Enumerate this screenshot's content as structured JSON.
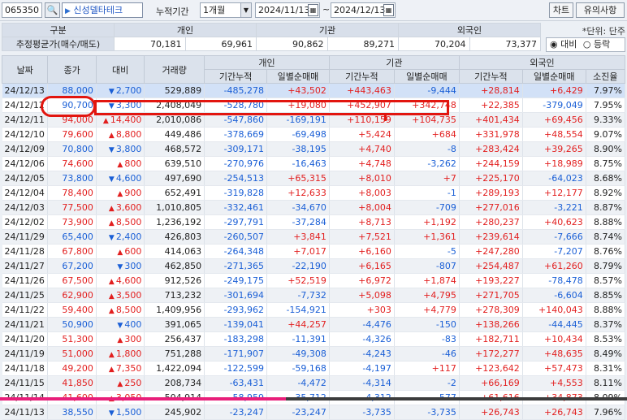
{
  "toolbar": {
    "code": "065350",
    "stock_name": "신성델타테크",
    "period_label": "누적기간",
    "period_value": "1개월",
    "date_from": "2024/11/13",
    "date_sep": "~",
    "date_to": "2024/12/13",
    "chart_button": "차트",
    "notice_button": "유의사항"
  },
  "summary": {
    "header": [
      "구분",
      "개인",
      "기관",
      "외국인"
    ],
    "row_label": "추정평균가(매수/매도)",
    "values": [
      "70,181",
      "69,961",
      "90,862",
      "89,271",
      "70,204",
      "73,377"
    ]
  },
  "unit_label": "*단위: 단주",
  "radio": {
    "selected": "대비",
    "other": "등락"
  },
  "grid": {
    "headers_top": [
      "날짜",
      "종가",
      "대비",
      "거래량",
      "개인",
      "기관",
      "외국인"
    ],
    "headers_sub": [
      "기간누적",
      "일별순매매",
      "기간누적",
      "일별순매매",
      "기간누적",
      "일별순매매",
      "소진율"
    ],
    "rows": [
      {
        "date": "24/12/13",
        "close": "88,000",
        "dir": "down",
        "chg": "2,700",
        "vol": "529,889",
        "p_cum": "-485,278",
        "p_day": "+43,502",
        "i_cum": "+443,463",
        "i_day": "-9,444",
        "f_cum": "+28,814",
        "f_day": "+6,429",
        "rate": "7.97%"
      },
      {
        "date": "24/12/12",
        "close": "90,700",
        "dir": "down",
        "chg": "3,300",
        "vol": "2,408,049",
        "p_cum": "-528,780",
        "p_day": "+19,080",
        "i_cum": "+452,907",
        "i_day": "+342,748",
        "f_cum": "+22,385",
        "f_day": "-379,049",
        "rate": "7.95%"
      },
      {
        "date": "24/12/11",
        "close": "94,000",
        "dir": "up",
        "chg": "14,400",
        "vol": "2,010,086",
        "p_cum": "-547,860",
        "p_day": "-169,191",
        "i_cum": "+110,159",
        "i_day": "+104,735",
        "f_cum": "+401,434",
        "f_day": "+69,456",
        "rate": "9.33%"
      },
      {
        "date": "24/12/10",
        "close": "79,600",
        "dir": "up",
        "chg": "8,800",
        "vol": "449,486",
        "p_cum": "-378,669",
        "p_day": "-69,498",
        "i_cum": "+5,424",
        "i_day": "+684",
        "f_cum": "+331,978",
        "f_day": "+48,554",
        "rate": "9.07%"
      },
      {
        "date": "24/12/09",
        "close": "70,800",
        "dir": "down",
        "chg": "3,800",
        "vol": "468,572",
        "p_cum": "-309,171",
        "p_day": "-38,195",
        "i_cum": "+4,740",
        "i_day": "-8",
        "f_cum": "+283,424",
        "f_day": "+39,265",
        "rate": "8.90%"
      },
      {
        "date": "24/12/06",
        "close": "74,600",
        "dir": "up",
        "chg": "800",
        "vol": "639,510",
        "p_cum": "-270,976",
        "p_day": "-16,463",
        "i_cum": "+4,748",
        "i_day": "-3,262",
        "f_cum": "+244,159",
        "f_day": "+18,989",
        "rate": "8.75%"
      },
      {
        "date": "24/12/05",
        "close": "73,800",
        "dir": "down",
        "chg": "4,600",
        "vol": "497,690",
        "p_cum": "-254,513",
        "p_day": "+65,315",
        "i_cum": "+8,010",
        "i_day": "+7",
        "f_cum": "+225,170",
        "f_day": "-64,023",
        "rate": "8.68%"
      },
      {
        "date": "24/12/04",
        "close": "78,400",
        "dir": "up",
        "chg": "900",
        "vol": "652,491",
        "p_cum": "-319,828",
        "p_day": "+12,633",
        "i_cum": "+8,003",
        "i_day": "-1",
        "f_cum": "+289,193",
        "f_day": "+12,177",
        "rate": "8.92%"
      },
      {
        "date": "24/12/03",
        "close": "77,500",
        "dir": "up",
        "chg": "3,600",
        "vol": "1,010,805",
        "p_cum": "-332,461",
        "p_day": "-34,670",
        "i_cum": "+8,004",
        "i_day": "-709",
        "f_cum": "+277,016",
        "f_day": "-3,221",
        "rate": "8.87%"
      },
      {
        "date": "24/12/02",
        "close": "73,900",
        "dir": "up",
        "chg": "8,500",
        "vol": "1,236,192",
        "p_cum": "-297,791",
        "p_day": "-37,284",
        "i_cum": "+8,713",
        "i_day": "+1,192",
        "f_cum": "+280,237",
        "f_day": "+40,623",
        "rate": "8.88%"
      },
      {
        "date": "24/11/29",
        "close": "65,400",
        "dir": "down",
        "chg": "2,400",
        "vol": "426,803",
        "p_cum": "-260,507",
        "p_day": "+3,841",
        "i_cum": "+7,521",
        "i_day": "+1,361",
        "f_cum": "+239,614",
        "f_day": "-7,666",
        "rate": "8.74%"
      },
      {
        "date": "24/11/28",
        "close": "67,800",
        "dir": "up",
        "chg": "600",
        "vol": "414,063",
        "p_cum": "-264,348",
        "p_day": "+7,017",
        "i_cum": "+6,160",
        "i_day": "-5",
        "f_cum": "+247,280",
        "f_day": "-7,207",
        "rate": "8.76%"
      },
      {
        "date": "24/11/27",
        "close": "67,200",
        "dir": "down",
        "chg": "300",
        "vol": "462,850",
        "p_cum": "-271,365",
        "p_day": "-22,190",
        "i_cum": "+6,165",
        "i_day": "-807",
        "f_cum": "+254,487",
        "f_day": "+61,260",
        "rate": "8.79%"
      },
      {
        "date": "24/11/26",
        "close": "67,500",
        "dir": "up",
        "chg": "4,600",
        "vol": "912,526",
        "p_cum": "-249,175",
        "p_day": "+52,519",
        "i_cum": "+6,972",
        "i_day": "+1,874",
        "f_cum": "+193,227",
        "f_day": "-78,478",
        "rate": "8.57%"
      },
      {
        "date": "24/11/25",
        "close": "62,900",
        "dir": "up",
        "chg": "3,500",
        "vol": "713,232",
        "p_cum": "-301,694",
        "p_day": "-7,732",
        "i_cum": "+5,098",
        "i_day": "+4,795",
        "f_cum": "+271,705",
        "f_day": "-6,604",
        "rate": "8.85%"
      },
      {
        "date": "24/11/22",
        "close": "59,400",
        "dir": "up",
        "chg": "8,500",
        "vol": "1,409,956",
        "p_cum": "-293,962",
        "p_day": "-154,921",
        "i_cum": "+303",
        "i_day": "+4,779",
        "f_cum": "+278,309",
        "f_day": "+140,043",
        "rate": "8.88%"
      },
      {
        "date": "24/11/21",
        "close": "50,900",
        "dir": "down",
        "chg": "400",
        "vol": "391,065",
        "p_cum": "-139,041",
        "p_day": "+44,257",
        "i_cum": "-4,476",
        "i_day": "-150",
        "f_cum": "+138,266",
        "f_day": "-44,445",
        "rate": "8.37%"
      },
      {
        "date": "24/11/20",
        "close": "51,300",
        "dir": "up",
        "chg": "300",
        "vol": "256,437",
        "p_cum": "-183,298",
        "p_day": "-11,391",
        "i_cum": "-4,326",
        "i_day": "-83",
        "f_cum": "+182,711",
        "f_day": "+10,434",
        "rate": "8.53%"
      },
      {
        "date": "24/11/19",
        "close": "51,000",
        "dir": "up",
        "chg": "1,800",
        "vol": "751,288",
        "p_cum": "-171,907",
        "p_day": "-49,308",
        "i_cum": "-4,243",
        "i_day": "-46",
        "f_cum": "+172,277",
        "f_day": "+48,635",
        "rate": "8.49%"
      },
      {
        "date": "24/11/18",
        "close": "49,200",
        "dir": "up",
        "chg": "7,350",
        "vol": "1,422,094",
        "p_cum": "-122,599",
        "p_day": "-59,168",
        "i_cum": "-4,197",
        "i_day": "+117",
        "f_cum": "+123,642",
        "f_day": "+57,473",
        "rate": "8.31%"
      },
      {
        "date": "24/11/15",
        "close": "41,850",
        "dir": "up",
        "chg": "250",
        "vol": "208,734",
        "p_cum": "-63,431",
        "p_day": "-4,472",
        "i_cum": "-4,314",
        "i_day": "-2",
        "f_cum": "+66,169",
        "f_day": "+4,553",
        "rate": "8.11%"
      },
      {
        "date": "24/11/14",
        "close": "41,600",
        "dir": "up",
        "chg": "3,050",
        "vol": "504,914",
        "p_cum": "-58,959",
        "p_day": "-35,712",
        "i_cum": "-4,312",
        "i_day": "-577",
        "f_cum": "+61,616",
        "f_day": "+34,873",
        "rate": "8.09%"
      },
      {
        "date": "24/11/13",
        "close": "38,550",
        "dir": "down",
        "chg": "1,500",
        "vol": "245,902",
        "p_cum": "-23,247",
        "p_day": "-23,247",
        "i_cum": "-3,735",
        "i_day": "-3,735",
        "f_cum": "+26,743",
        "f_day": "+26,743",
        "rate": "7.96%"
      }
    ]
  },
  "colors": {
    "up": "#e21f1f",
    "down": "#1a5fd6",
    "highlight": "#e2150f"
  },
  "icons": [
    "search-icon",
    "caret-right-icon",
    "dropdown-icon",
    "calendar-icon"
  ]
}
